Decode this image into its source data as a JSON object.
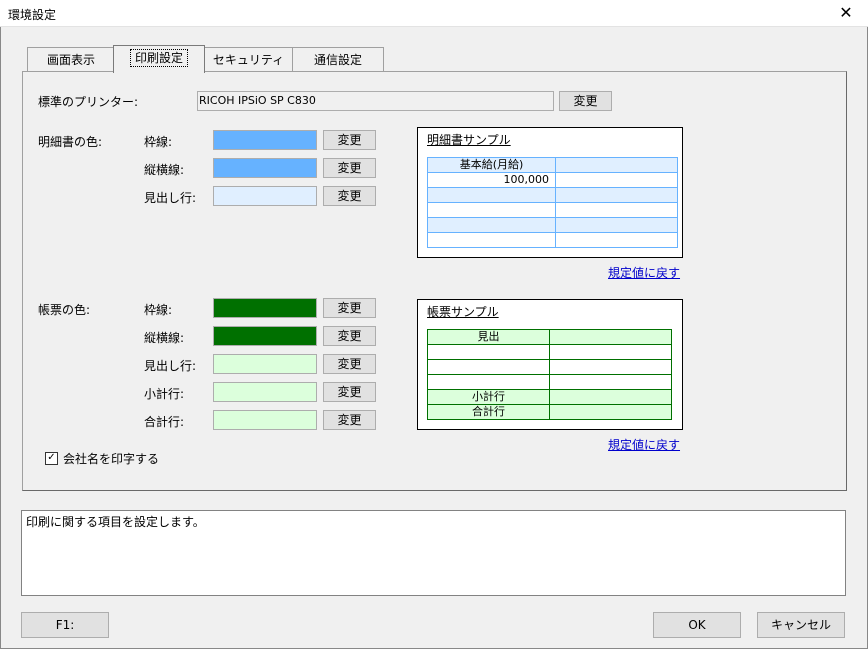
{
  "window": {
    "title": "環境設定",
    "close_glyph": "✕"
  },
  "tabs": [
    {
      "label": "画面表示"
    },
    {
      "label": "印刷設定"
    },
    {
      "label": "セキュリティ"
    },
    {
      "label": "通信設定"
    }
  ],
  "printer": {
    "label": "標準のプリンター:",
    "value": "RICOH IPSiO SP C830",
    "change_label": "変更"
  },
  "meisai": {
    "section_label": "明細書の色:",
    "rows": [
      {
        "label": "枠線:",
        "color": "#66b2ff",
        "button": "変更"
      },
      {
        "label": "縦横線:",
        "color": "#66b2ff",
        "button": "変更"
      },
      {
        "label": "見出し行:",
        "color": "#e0efff",
        "button": "変更"
      }
    ],
    "sample": {
      "title": "明細書サンプル",
      "header": "基本給(月給)",
      "value": "100,000",
      "border_color": "#66b2ff",
      "header_bg": "#e0efff"
    },
    "reset_link": "規定値に戻す"
  },
  "chouhyou": {
    "section_label": "帳票の色:",
    "rows": [
      {
        "label": "枠線:",
        "color": "#007000",
        "button": "変更"
      },
      {
        "label": "縦横線:",
        "color": "#007000",
        "button": "変更"
      },
      {
        "label": "見出し行:",
        "color": "#dcffdc",
        "button": "変更"
      },
      {
        "label": "小計行:",
        "color": "#dcffdc",
        "button": "変更"
      },
      {
        "label": "合計行:",
        "color": "#dcffdc",
        "button": "変更"
      }
    ],
    "sample": {
      "title": "帳票サンプル",
      "header": "見出",
      "subtotal": "小計行",
      "total": "合計行",
      "border_color": "#007000",
      "fill": "#dcffdc"
    },
    "reset_link": "規定値に戻す"
  },
  "print_company": {
    "label": "会社名を印字する",
    "checked": true,
    "check_glyph": "✓"
  },
  "description": "印刷に関する項目を設定します。",
  "footer": {
    "f1": "F1:",
    "ok": "OK",
    "cancel": "キャンセル"
  }
}
